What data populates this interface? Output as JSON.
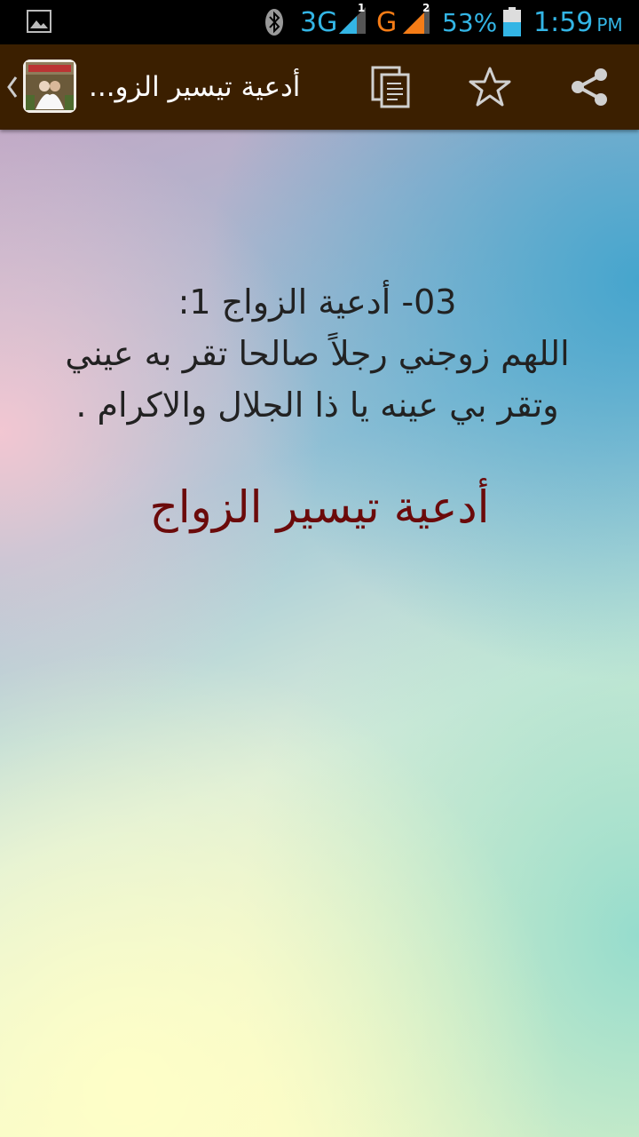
{
  "status_bar": {
    "net1": "3G",
    "sim1_number": "1",
    "net2": "G",
    "sim2_number": "2",
    "battery_percent": "53%",
    "time": "1:59",
    "ampm": "PM",
    "battery_level": 0.53,
    "colors": {
      "primary": "#33b5e5",
      "net2": "#f57c16"
    },
    "icons": [
      "image-notification-icon",
      "bluetooth-icon",
      "signal-icon",
      "battery-icon"
    ]
  },
  "action_bar": {
    "title": "أدعية تيسير الزو...",
    "background": "#3b1f00",
    "actions": [
      {
        "name": "copy",
        "icon": "copy-icon"
      },
      {
        "name": "favorite",
        "icon": "star-icon"
      },
      {
        "name": "share",
        "icon": "share-icon"
      }
    ]
  },
  "content": {
    "heading_line": "03- أدعية الزواج  1:",
    "dua_line_1": "اللهم زوجني رجلاً صالحا تقر به عيني",
    "dua_line_2": "وتقر بي عينه يا ذا الجلال والاكرام  .",
    "subtitle": "أدعية تيسير الزواج",
    "subtitle_color": "#6b0a0a"
  }
}
